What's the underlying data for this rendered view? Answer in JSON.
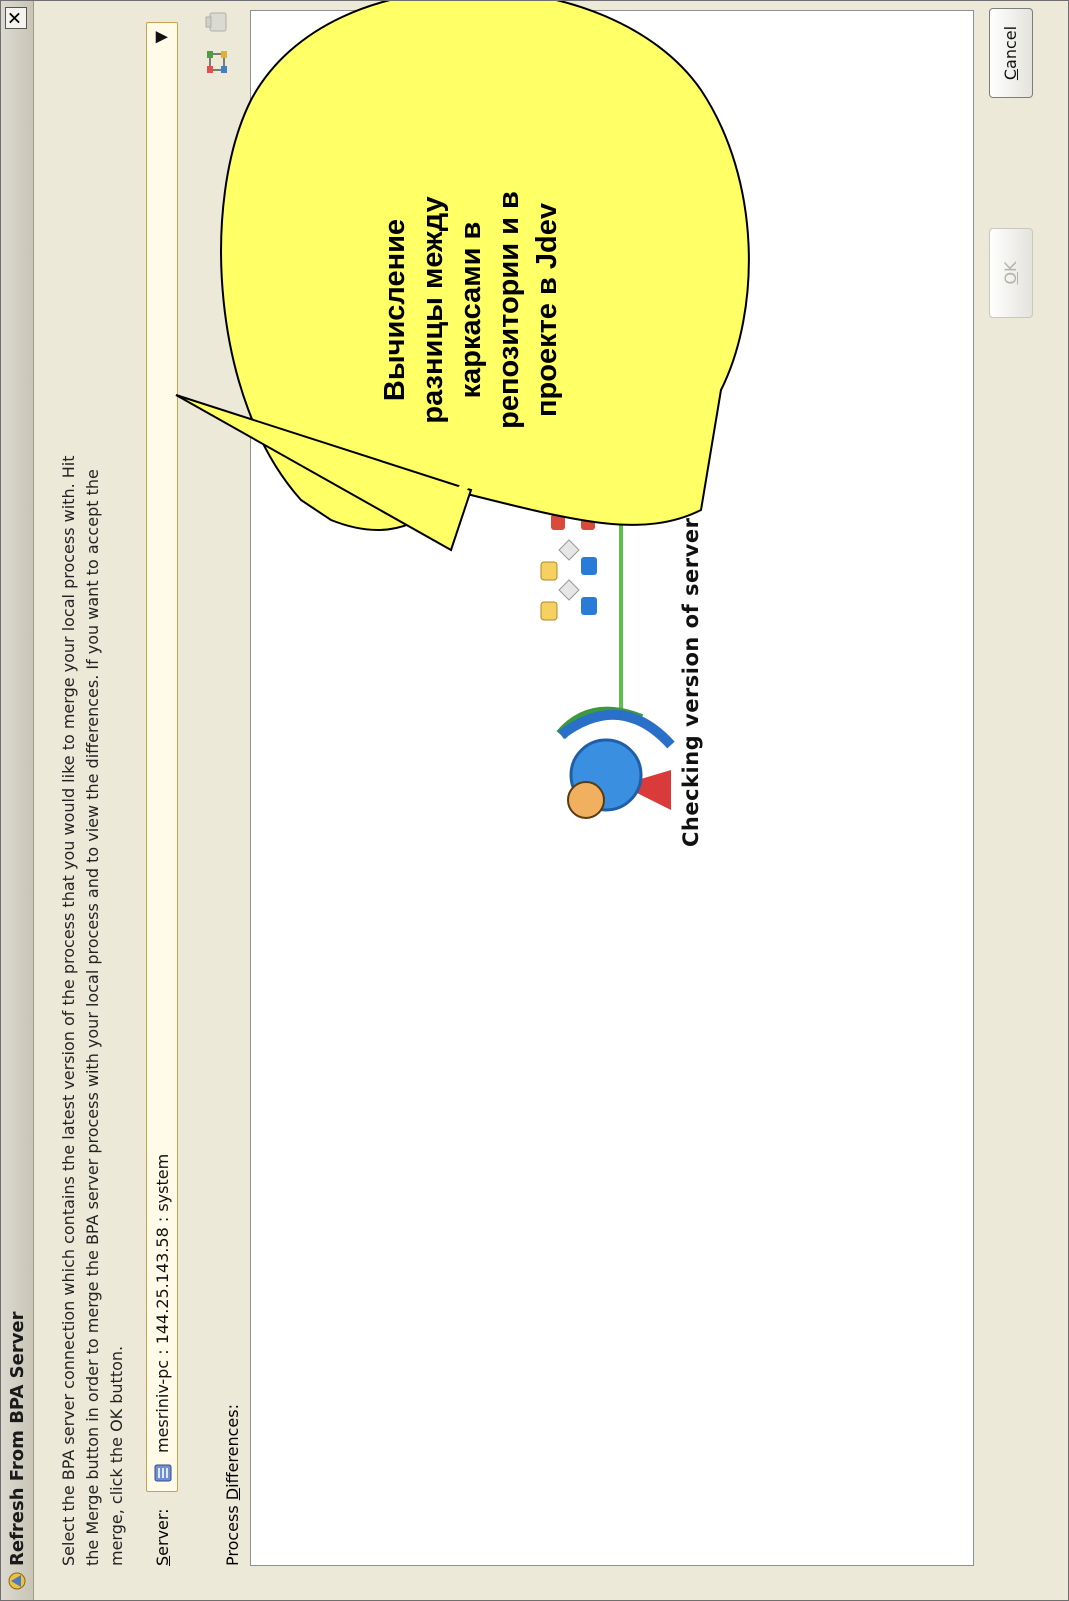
{
  "window": {
    "title": "Refresh From BPA Server",
    "close_label": "✕"
  },
  "instructions": {
    "line1": "Select the BPA server connection which contains the latest version of the process that you would like to merge your local process with. Hit",
    "line2": "the Merge button in order to merge the BPA server process with your local process and to view the differences. If you want to accept the",
    "line3": "merge, click the OK button."
  },
  "server": {
    "label_mnemonic": "S",
    "label_rest": "erver:",
    "value": "mesriniv-pc : 144.25.143.58 : system",
    "dropdown_arrow": "▼"
  },
  "process_differences": {
    "label_prefix": "Process ",
    "label_mnemonic": "D",
    "label_rest": "ifferences:"
  },
  "status": {
    "text": "Checking version of server model..."
  },
  "buttons": {
    "ok_mnemonic": "O",
    "ok_rest": "K",
    "cancel_mnemonic": "C",
    "cancel_rest": "ancel"
  },
  "callout": {
    "line1": "Вычисление",
    "line2": "разницы между",
    "line3": "каркасами в",
    "line4": "репозитории и в",
    "line5": "проекте в Jdev",
    "fill_color": "#ffff66"
  },
  "icons": {
    "title": "bpa-app-icon",
    "server": "server-connection-icon",
    "tool1": "process-diagram-icon",
    "tool2": "clear-icon"
  }
}
